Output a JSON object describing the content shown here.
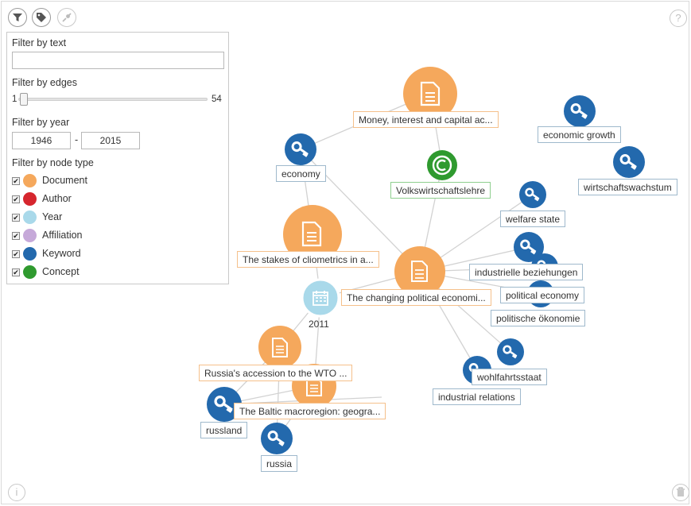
{
  "toolbar": {
    "filter_icon": "funnel-icon",
    "tag_icon": "tag-icon",
    "pin_icon": "pushpin-icon"
  },
  "corner": {
    "help_glyph": "?",
    "info_glyph": "i",
    "trash_icon": "trash-icon"
  },
  "filters": {
    "text_label": "Filter by text",
    "text_value": "",
    "edges_label": "Filter by edges",
    "edges_min": "1",
    "edges_max": "54",
    "edges_value": 1,
    "year_label": "Filter by year",
    "year_from": "1946",
    "year_sep": "-",
    "year_to": "2015",
    "type_label": "Filter by node type",
    "types": [
      {
        "label": "Document",
        "color": "#f5a85c",
        "checked": true
      },
      {
        "label": "Author",
        "color": "#d6262e",
        "checked": true
      },
      {
        "label": "Year",
        "color": "#a9d9ea",
        "checked": true
      },
      {
        "label": "Affiliation",
        "color": "#c6a9d9",
        "checked": true
      },
      {
        "label": "Keyword",
        "color": "#2369ad",
        "checked": true
      },
      {
        "label": "Concept",
        "color": "#2f9a2f",
        "checked": true
      }
    ]
  },
  "graph": {
    "doc_icon": "document-icon",
    "keyword_icon": "key-icon",
    "concept_icon": "copyright-icon",
    "year_icon": "calendar-icon",
    "nodes": {
      "doc_money": {
        "type": "document",
        "label": "Money, interest and capital ac..."
      },
      "doc_stakes": {
        "type": "document",
        "label": "The stakes of cliometrics in a..."
      },
      "doc_changing": {
        "type": "document",
        "label": "The changing political economi..."
      },
      "doc_russia": {
        "type": "document",
        "label": "Russia's accession to the WTO ..."
      },
      "doc_baltic": {
        "type": "document",
        "label": "The Baltic macroregion: geogra..."
      },
      "kw_economy": {
        "type": "keyword",
        "label": "economy"
      },
      "kw_econ_growth": {
        "type": "keyword",
        "label": "economic growth"
      },
      "kw_wirtschafts": {
        "type": "keyword",
        "label": "wirtschaftswachstum"
      },
      "kw_welfare": {
        "type": "keyword",
        "label": "welfare state"
      },
      "kw_industrielle": {
        "type": "keyword",
        "label": "industrielle beziehungen"
      },
      "kw_political": {
        "type": "keyword",
        "label": "political economy"
      },
      "kw_politische": {
        "type": "keyword",
        "label": "politische ökonomie"
      },
      "kw_wohlfahrt": {
        "type": "keyword",
        "label": "wohlfahrtsstaat"
      },
      "kw_industrial": {
        "type": "keyword",
        "label": "industrial relations"
      },
      "kw_russland": {
        "type": "keyword",
        "label": "russland"
      },
      "kw_russia": {
        "type": "keyword",
        "label": "russia"
      },
      "concept_vwl": {
        "type": "concept",
        "label": "Volkswirtschaftslehre"
      },
      "year_2011": {
        "type": "year",
        "label": "2011"
      }
    }
  }
}
